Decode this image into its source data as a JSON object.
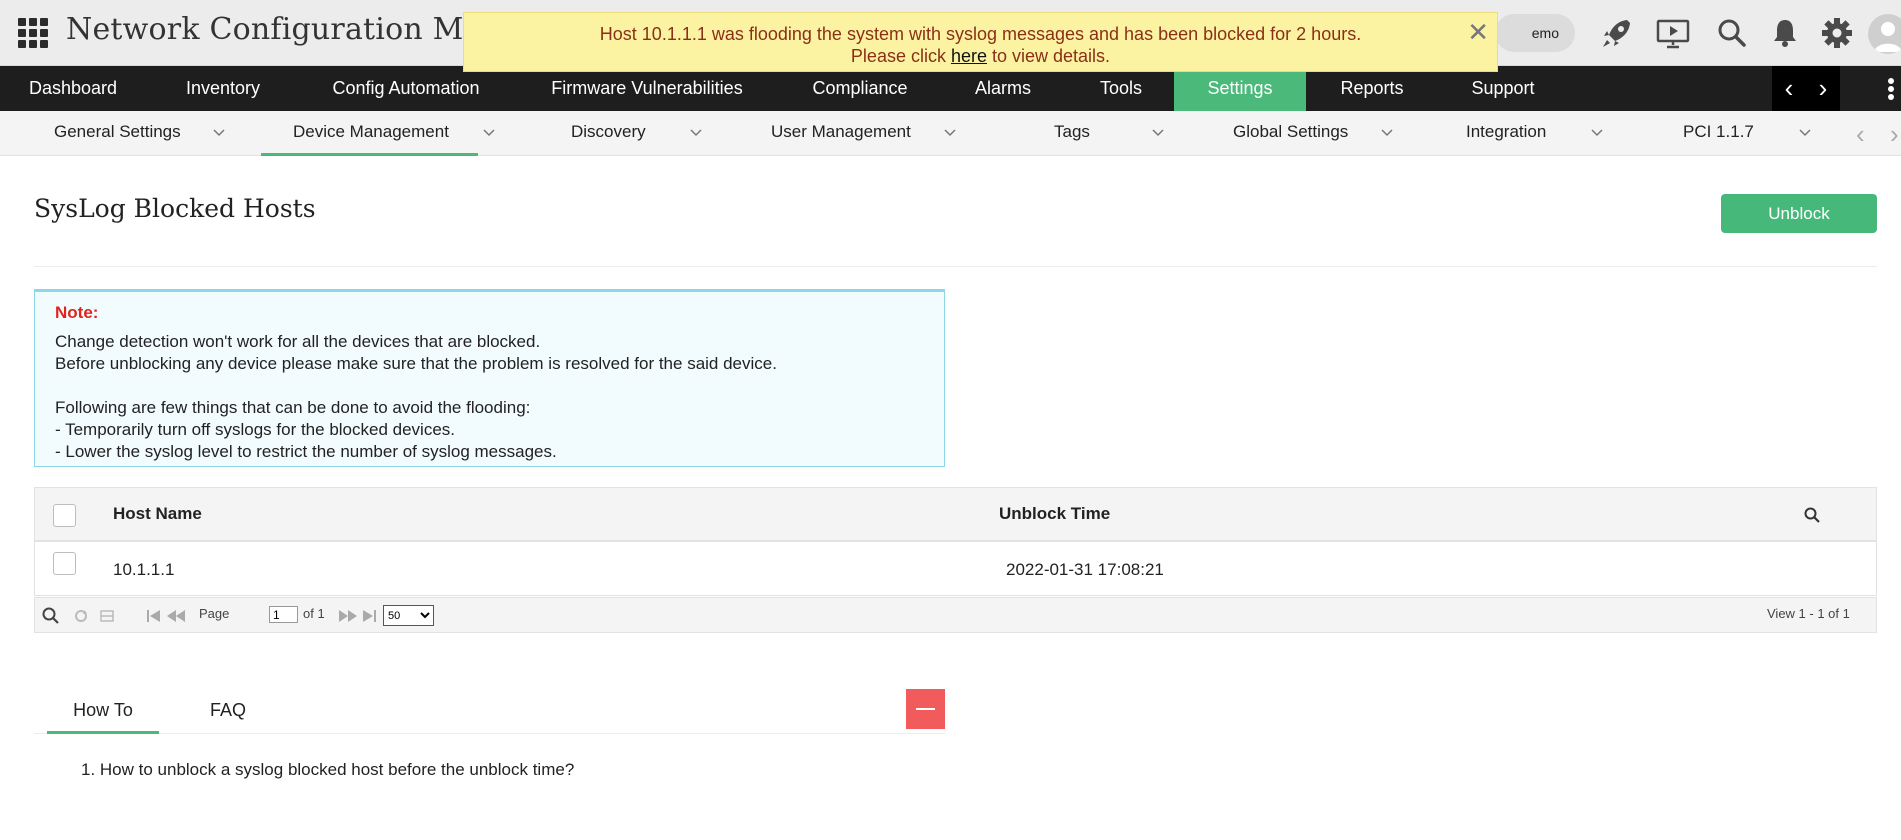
{
  "header": {
    "app_title": "Network Configuration Manager",
    "demo_label": "emo",
    "icons": [
      "rocket-icon",
      "presentation-icon",
      "search-icon",
      "bell-icon",
      "gear-icon",
      "user-avatar-icon"
    ]
  },
  "banner": {
    "line1": "Host 10.1.1.1 was flooding the system with syslog messages and has been blocked for 2 hours.",
    "line2_prefix": "Please click ",
    "link": "here",
    "line2_suffix": " to view details.",
    "close_glyph": "✕"
  },
  "main_nav": {
    "items": [
      "Dashboard",
      "Inventory",
      "Config Automation",
      "Firmware Vulnerabilities",
      "Compliance",
      "Alarms",
      "Tools",
      "Settings",
      "Reports",
      "Support"
    ],
    "active": "Settings",
    "prev_glyph": "‹",
    "next_glyph": "›"
  },
  "sub_nav": {
    "items": [
      "General Settings",
      "Device Management",
      "Discovery",
      "User Management",
      "Tags",
      "Global Settings",
      "Integration",
      "PCI 1.1.7"
    ],
    "active": "Device Management",
    "prev_glyph": "‹",
    "next_glyph": "›"
  },
  "page": {
    "title": "SysLog Blocked Hosts",
    "unblock_button": "Unblock"
  },
  "note": {
    "title": "Note:",
    "line1": "Change detection won't work for all the devices that are blocked.",
    "line2": "Before unblocking any device please make sure that the problem is resolved for the said device.",
    "line3": "Following are few things that can be done to avoid the flooding:",
    "line4": "- Temporarily turn off syslogs for the blocked devices.",
    "line5": "- Lower the syslog level to restrict the number of syslog messages."
  },
  "table": {
    "columns": [
      "Host Name",
      "Unblock Time"
    ],
    "rows": [
      {
        "host": "10.1.1.1",
        "unblock_time": "2022-01-31 17:08:21"
      }
    ]
  },
  "pager": {
    "page_label": "Page",
    "page_value": "1",
    "of_label": "of 1",
    "page_size": "50",
    "view_text": "View 1 - 1 of 1"
  },
  "help": {
    "tabs": [
      "How To",
      "FAQ"
    ],
    "active_tab": "How To",
    "items": [
      "1. How to unblock a syslog blocked host before the unblock time?"
    ]
  },
  "colors": {
    "accent": "#4ab97a",
    "nav_bg": "#1e1e1e",
    "banner_bg": "#fbf3a1",
    "note_title": "#e0241b",
    "collapse_button": "#f15b5b"
  }
}
